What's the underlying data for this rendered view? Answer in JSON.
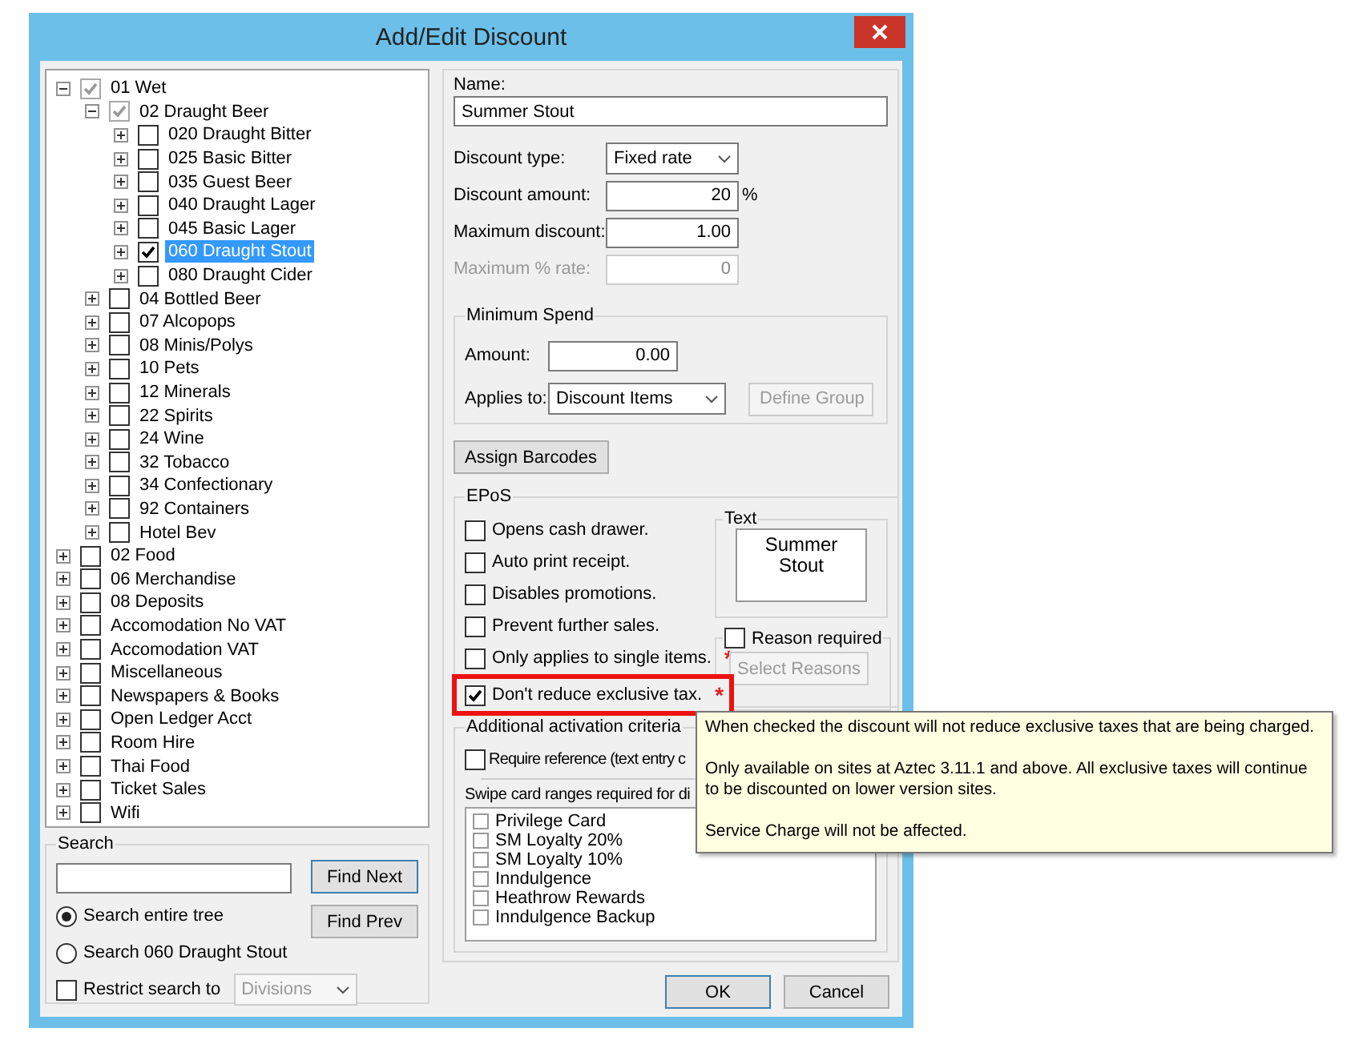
{
  "window": {
    "title": "Add/Edit Discount"
  },
  "tree": [
    {
      "label": "01 Wet",
      "checked": true,
      "greyed": true,
      "expanded": true,
      "selected": false,
      "children": [
        {
          "label": "02 Draught Beer",
          "checked": true,
          "greyed": true,
          "expanded": true,
          "selected": false,
          "children": [
            {
              "label": "020 Draught Bitter",
              "checked": false,
              "greyed": false,
              "expanded": false,
              "selected": false
            },
            {
              "label": "025 Basic Bitter",
              "checked": false,
              "greyed": false,
              "expanded": false,
              "selected": false
            },
            {
              "label": "035 Guest Beer",
              "checked": false,
              "greyed": false,
              "expanded": false,
              "selected": false
            },
            {
              "label": "040 Draught Lager",
              "checked": false,
              "greyed": false,
              "expanded": false,
              "selected": false
            },
            {
              "label": "045 Basic Lager",
              "checked": false,
              "greyed": false,
              "expanded": false,
              "selected": false
            },
            {
              "label": "060 Draught Stout",
              "checked": true,
              "greyed": false,
              "expanded": false,
              "selected": true
            },
            {
              "label": "080 Draught Cider",
              "checked": false,
              "greyed": false,
              "expanded": false,
              "selected": false
            }
          ]
        },
        {
          "label": "04 Bottled Beer",
          "checked": false,
          "greyed": false,
          "expanded": false,
          "selected": false
        },
        {
          "label": "07 Alcopops",
          "checked": false,
          "greyed": false,
          "expanded": false,
          "selected": false
        },
        {
          "label": "08 Minis/Polys",
          "checked": false,
          "greyed": false,
          "expanded": false,
          "selected": false
        },
        {
          "label": "10 Pets",
          "checked": false,
          "greyed": false,
          "expanded": false,
          "selected": false
        },
        {
          "label": "12 Minerals",
          "checked": false,
          "greyed": false,
          "expanded": false,
          "selected": false
        },
        {
          "label": "22 Spirits",
          "checked": false,
          "greyed": false,
          "expanded": false,
          "selected": false
        },
        {
          "label": "24 Wine",
          "checked": false,
          "greyed": false,
          "expanded": false,
          "selected": false
        },
        {
          "label": "32 Tobacco",
          "checked": false,
          "greyed": false,
          "expanded": false,
          "selected": false
        },
        {
          "label": "34 Confectionary",
          "checked": false,
          "greyed": false,
          "expanded": false,
          "selected": false
        },
        {
          "label": "92 Containers",
          "checked": false,
          "greyed": false,
          "expanded": false,
          "selected": false
        },
        {
          "label": "Hotel Bev",
          "checked": false,
          "greyed": false,
          "expanded": false,
          "selected": false
        }
      ]
    },
    {
      "label": "02 Food",
      "checked": false,
      "greyed": false,
      "expanded": false,
      "selected": false
    },
    {
      "label": "06 Merchandise",
      "checked": false,
      "greyed": false,
      "expanded": false,
      "selected": false
    },
    {
      "label": "08 Deposits",
      "checked": false,
      "greyed": false,
      "expanded": false,
      "selected": false
    },
    {
      "label": "Accomodation No VAT",
      "checked": false,
      "greyed": false,
      "expanded": false,
      "selected": false
    },
    {
      "label": "Accomodation VAT",
      "checked": false,
      "greyed": false,
      "expanded": false,
      "selected": false
    },
    {
      "label": "Miscellaneous",
      "checked": false,
      "greyed": false,
      "expanded": false,
      "selected": false
    },
    {
      "label": "Newspapers & Books",
      "checked": false,
      "greyed": false,
      "expanded": false,
      "selected": false
    },
    {
      "label": "Open Ledger Acct",
      "checked": false,
      "greyed": false,
      "expanded": false,
      "selected": false
    },
    {
      "label": "Room Hire",
      "checked": false,
      "greyed": false,
      "expanded": false,
      "selected": false
    },
    {
      "label": "Thai Food",
      "checked": false,
      "greyed": false,
      "expanded": false,
      "selected": false
    },
    {
      "label": "Ticket Sales",
      "checked": false,
      "greyed": false,
      "expanded": false,
      "selected": false
    },
    {
      "label": "Wifi",
      "checked": false,
      "greyed": false,
      "expanded": false,
      "selected": false
    }
  ],
  "search": {
    "title": "Search",
    "find_next": "Find Next",
    "find_prev": "Find Prev",
    "scopes": [
      {
        "label": "Search entire tree",
        "selected": true
      },
      {
        "label": "Search 060 Draught Stout",
        "selected": false
      }
    ],
    "restrict": {
      "label": "Restrict search to",
      "checked": false,
      "value": "Divisions",
      "disabled": true
    }
  },
  "details": {
    "name_label": "Name:",
    "name": "Summer Stout",
    "fields": [
      {
        "kind": "select",
        "label": "Discount type:",
        "value": "Fixed rate",
        "disabled": false
      },
      {
        "kind": "number",
        "label": "Discount amount:",
        "value": "20",
        "suffix": "%",
        "disabled": false
      },
      {
        "kind": "number",
        "label": "Maximum discount:",
        "value": "1.00",
        "disabled": false
      },
      {
        "kind": "number",
        "label": "Maximum % rate:",
        "value": "0",
        "disabled": true
      }
    ],
    "minimum_spend": {
      "title": "Minimum Spend",
      "amount_label": "Amount:",
      "amount": "0.00",
      "applies_label": "Applies to:",
      "applies": "Discount Items",
      "define_group": "Define Group",
      "define_group_disabled": true
    },
    "assign_barcodes": "Assign Barcodes"
  },
  "epos": {
    "title": "EPoS",
    "options": [
      {
        "label": "Opens cash drawer.",
        "checked": false,
        "highlighted": false
      },
      {
        "label": "Auto print receipt.",
        "checked": false,
        "highlighted": false
      },
      {
        "label": "Disables promotions.",
        "checked": false,
        "highlighted": false
      },
      {
        "label": "Prevent further sales.",
        "checked": false,
        "highlighted": false
      },
      {
        "label": "Only applies to single items.",
        "checked": false,
        "highlighted": false,
        "marker": "*"
      },
      {
        "label": "Don't reduce exclusive tax.",
        "checked": true,
        "highlighted": true,
        "marker": "*"
      }
    ],
    "text_title": "Text",
    "text": "Summer Stout",
    "reason": {
      "label": "Reason required",
      "checked": false,
      "button": "Select Reasons",
      "button_disabled": true
    }
  },
  "activation": {
    "title": "Additional activation criteria",
    "require_reference": {
      "label": "Require reference (text entry c",
      "checked": false
    },
    "swipe_label": "Swipe card ranges required for di",
    "cards": [
      {
        "label": "Privilege Card",
        "checked": false
      },
      {
        "label": "SM Loyalty 20%",
        "checked": false
      },
      {
        "label": "SM Loyalty 10%",
        "checked": false
      },
      {
        "label": "Inndulgence",
        "checked": false
      },
      {
        "label": "Heathrow Rewards",
        "checked": false
      },
      {
        "label": "Inndulgence Backup",
        "checked": false
      }
    ]
  },
  "buttons": {
    "ok": "OK",
    "cancel": "Cancel"
  },
  "tooltip": [
    "When checked the discount will not reduce exclusive taxes that are being charged.",
    "Only available on sites at Aztec 3.11.1 and above.  All exclusive taxes will continue to be discounted on lower version sites.",
    "Service Charge will not be affected."
  ]
}
